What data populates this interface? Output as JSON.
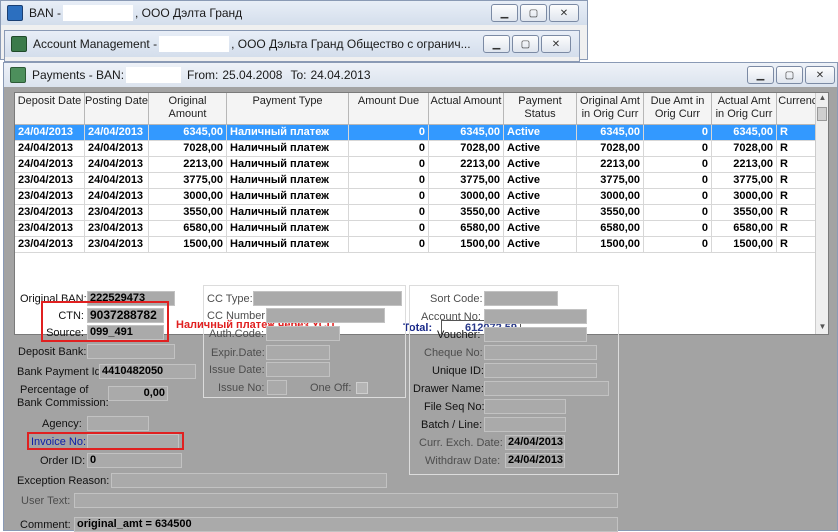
{
  "windows": {
    "ban": {
      "prefix": "BAN - ",
      "suffix": ", ООО Дэлта Гранд"
    },
    "account": {
      "prefix": "Account Management - ",
      "suffix": ", ООО Дэльта Гранд Общество с огранич..."
    },
    "payments": {
      "prefix": "Payments - BAN:",
      "from_label": "From:",
      "from": "25.04.2008",
      "to_label": "To:",
      "to": "24.04.2013"
    }
  },
  "titlebar_buttons": {
    "minimize": "▁",
    "maximize": "▢",
    "close": "✕"
  },
  "grid": {
    "columns": [
      "Deposit Date",
      "Posting Date",
      "Original Amount",
      "Payment Type",
      "Amount Due",
      "Actual Amount",
      "Payment Status",
      "Original Amt in Orig Curr",
      "Due Amt in Orig Curr",
      "Actual Amt in Orig Curr",
      "Currency"
    ],
    "rows": [
      [
        "24/04/2013",
        "24/04/2013",
        "6345,00",
        "Наличный платеж",
        "0",
        "6345,00",
        "Active",
        "6345,00",
        "0",
        "6345,00",
        "R"
      ],
      [
        "24/04/2013",
        "24/04/2013",
        "7028,00",
        "Наличный платеж",
        "0",
        "7028,00",
        "Active",
        "7028,00",
        "0",
        "7028,00",
        "R"
      ],
      [
        "24/04/2013",
        "24/04/2013",
        "2213,00",
        "Наличный платеж",
        "0",
        "2213,00",
        "Active",
        "2213,00",
        "0",
        "2213,00",
        "R"
      ],
      [
        "23/04/2013",
        "24/04/2013",
        "3775,00",
        "Наличный платеж",
        "0",
        "3775,00",
        "Active",
        "3775,00",
        "0",
        "3775,00",
        "R"
      ],
      [
        "23/04/2013",
        "24/04/2013",
        "3000,00",
        "Наличный платеж",
        "0",
        "3000,00",
        "Active",
        "3000,00",
        "0",
        "3000,00",
        "R"
      ],
      [
        "23/04/2013",
        "23/04/2013",
        "3550,00",
        "Наличный платеж",
        "0",
        "3550,00",
        "Active",
        "3550,00",
        "0",
        "3550,00",
        "R"
      ],
      [
        "23/04/2013",
        "23/04/2013",
        "6580,00",
        "Наличный платеж",
        "0",
        "6580,00",
        "Active",
        "6580,00",
        "0",
        "6580,00",
        "R"
      ],
      [
        "23/04/2013",
        "23/04/2013",
        "1500,00",
        "Наличный платеж",
        "0",
        "1500,00",
        "Active",
        "1500,00",
        "0",
        "1500,00",
        "R"
      ]
    ],
    "total_label": "Total:",
    "total_value": "612072,59"
  },
  "details": {
    "original_ban_label": "Original BAN:",
    "original_ban": "222529473",
    "ctn_label": "CTN:",
    "ctn": "9037288782",
    "source_label": "Source:",
    "source": "099_491",
    "deposit_bank_label": "Deposit Bank:",
    "deposit_bank": "",
    "bank_payment_id_label": "Bank Payment Id:",
    "bank_payment_id": "4410482050",
    "percentage_label_1": "Percentage of",
    "percentage_label_2": "Bank Commission:",
    "percentage": "0,00",
    "agency_label": "Agency:",
    "agency": "",
    "invoice_label": "Invoice No:",
    "invoice": "",
    "order_id_label": "Order ID:",
    "order_id": "0",
    "exception_label": "Exception Reason:",
    "exception": "",
    "user_text_label": "User Text:",
    "user_text": "",
    "comment_label": "Comment:",
    "comment": "original_amt = 634500"
  },
  "cc": {
    "type_label": "CC Type:",
    "number_label": "CC Number:",
    "auth_label": "Auth.Code:",
    "expir_label": "Expir.Date:",
    "issue_date_label": "Issue Date:",
    "issue_no_label": "Issue No:",
    "one_off_label": "One Off:"
  },
  "bank": {
    "sort_code_label": "Sort Code:",
    "account_no_label": "Account No:",
    "voucher_label": "Voucher:",
    "cheque_label": "Cheque No:",
    "unique_id_label": "Unique ID:",
    "drawer_label": "Drawer Name:",
    "file_seq_label": "File Seq No:",
    "batch_label": "Batch / Line:",
    "curr_exch_label": "Curr. Exch. Date:",
    "curr_exch": "24/04/2013",
    "withdraw_label": "Withdraw Date:",
    "withdraw": "24/04/2013"
  },
  "annotation": "Наличный платеж через УСП",
  "colors": {
    "selection": "#3399ff",
    "annotation": "#e02020",
    "form_bg": "#a3a3a3"
  }
}
